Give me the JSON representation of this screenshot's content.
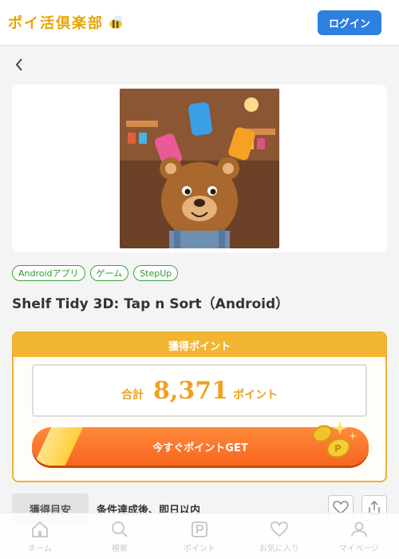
{
  "header": {
    "logo_text": "ポイ活倶楽部",
    "login_label": "ログイン"
  },
  "nav": {
    "back_icon": "chevron-left-icon"
  },
  "tags": [
    "Androidアプリ",
    "ゲーム",
    "StepUp"
  ],
  "app": {
    "title": "Shelf Tidy 3D: Tap n Sort（Android）"
  },
  "points": {
    "header": "獲得ポイント",
    "total_label": "合計",
    "value": "8,371",
    "unit": "ポイント",
    "cta": "今すぐポイントGET"
  },
  "guide": {
    "label": "獲得目安",
    "value": "条件達成後、即日以内"
  },
  "tabbar": [
    {
      "label": "ホーム",
      "icon": "home-icon"
    },
    {
      "label": "検索",
      "icon": "search-icon"
    },
    {
      "label": "ポイント",
      "icon": "point-icon"
    },
    {
      "label": "お気に入り",
      "icon": "heart-icon"
    },
    {
      "label": "マイページ",
      "icon": "user-icon"
    }
  ],
  "colors": {
    "accent": "#2d7fe0",
    "point": "#f0a020",
    "cta": "#f7651c",
    "tag": "#3aa63a"
  }
}
